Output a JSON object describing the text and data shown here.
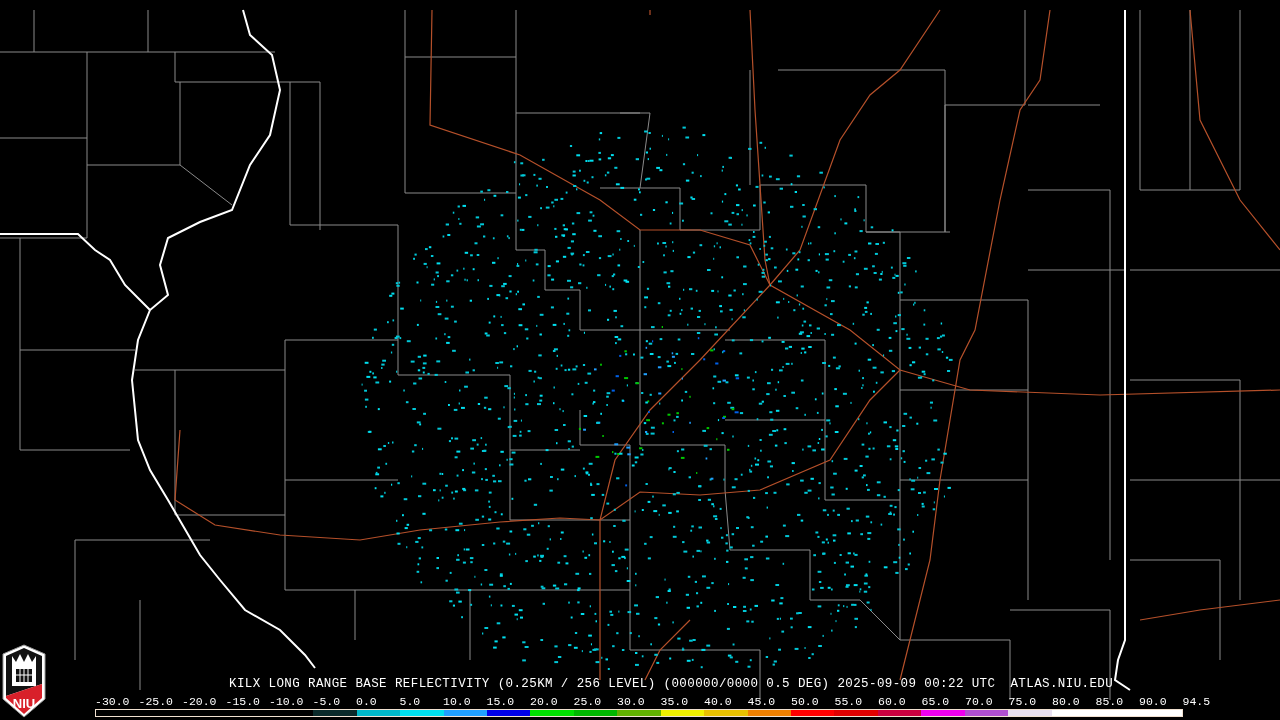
{
  "logo": {
    "text": "NIU"
  },
  "title": "KILX LONG RANGE BASE REFLECTIVITY (0.25KM / 256 LEVEL) (000000/0000 0.5 DEG) 2025-09-09 00:22 UTC",
  "source": "ATLAS.NIU.EDU",
  "legend": {
    "ticks": [
      "-30.0",
      "-25.0",
      "-20.0",
      "-15.0",
      "-10.0",
      "-5.0",
      "0.0",
      "5.0",
      "10.0",
      "15.0",
      "20.0",
      "25.0",
      "30.0",
      "35.0",
      "40.0",
      "45.0",
      "50.0",
      "55.0",
      "60.0",
      "65.0",
      "70.0",
      "75.0",
      "80.0",
      "85.0",
      "90.0",
      "94.5"
    ],
    "bands": [
      {
        "color": "#000000"
      },
      {
        "color": "#000000"
      },
      {
        "color": "#000000"
      },
      {
        "color": "#000000"
      },
      {
        "color": "#000000"
      },
      {
        "color": "#0a2a2a"
      },
      {
        "color": "#00b8c8"
      },
      {
        "color": "#00e0f0"
      },
      {
        "color": "#20a0ff"
      },
      {
        "color": "#0000e8"
      },
      {
        "color": "#00e000"
      },
      {
        "color": "#00b800"
      },
      {
        "color": "#60b000"
      },
      {
        "color": "#f0f000"
      },
      {
        "color": "#e8c000"
      },
      {
        "color": "#f08000"
      },
      {
        "color": "#ff0000"
      },
      {
        "color": "#e00000"
      },
      {
        "color": "#c80040"
      },
      {
        "color": "#f000f0"
      },
      {
        "color": "#b050d0"
      },
      {
        "color": "#e8e0f0"
      },
      {
        "color": "#ffffff"
      },
      {
        "color": "#ffffff"
      },
      {
        "color": "#ffffff"
      }
    ]
  }
}
